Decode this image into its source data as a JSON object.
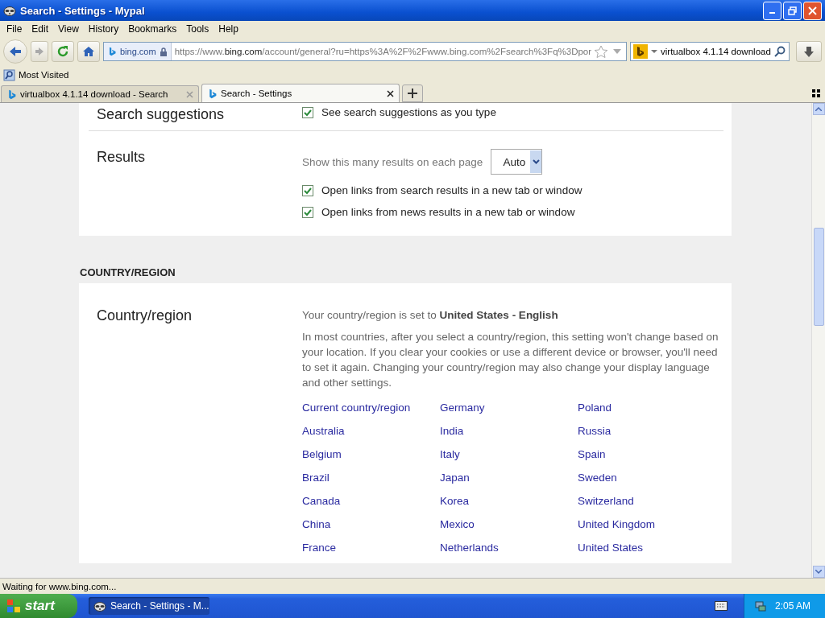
{
  "window": {
    "title": "Search - Settings - Mypal"
  },
  "menu": [
    "File",
    "Edit",
    "View",
    "History",
    "Bookmarks",
    "Tools",
    "Help"
  ],
  "navigation": {
    "site_label": "bing.com",
    "url": "https://www.**bing.com**/account/general?ru=https%3A%2F%2Fwww.bing.com%2Fsearch%3Fq%3Dpor",
    "search_value": "virtualbox 4.1.14 download"
  },
  "bookmarks": [
    "Most Visited"
  ],
  "tabs": [
    {
      "label": "virtualbox 4.1.14 download - Search",
      "selected": false
    },
    {
      "label": "Search - Settings",
      "selected": true
    }
  ],
  "settings": {
    "cut_row": {
      "title": "Search suggestions",
      "option": {
        "label": "See search suggestions as you type",
        "checked": true
      }
    },
    "results": {
      "title": "Results",
      "count_label": "Show this many results on each page",
      "count_value": "Auto",
      "options": [
        {
          "label": "Open links from search results in a new tab or window",
          "checked": true
        },
        {
          "label": "Open links from news results in a new tab or window",
          "checked": true
        }
      ]
    },
    "section_heading": "COUNTRY/REGION",
    "country": {
      "title": "Country/region",
      "current_text": "Your country/region is set to **United States - English**",
      "note": "In most countries, after you select a country/region, this setting won't change based on your location. If you clear your cookies or use a different device or browser, you'll need to set it again. Changing your country/region may also change your display language and other settings.",
      "links": [
        "Current country/region",
        "Germany",
        "Poland",
        "Australia",
        "India",
        "Russia",
        "Belgium",
        "Italy",
        "Spain",
        "Brazil",
        "Japan",
        "Sweden",
        "Canada",
        "Korea",
        "Switzerland",
        "China",
        "Mexico",
        "United Kingdom",
        "France",
        "Netherlands",
        "United States"
      ]
    }
  },
  "status_bar": "Waiting for www.bing.com...",
  "taskbar": {
    "start": "start",
    "windows": [
      {
        "label": "Search - Settings - M...",
        "selected": true
      }
    ],
    "clock": "2:05 AM"
  }
}
